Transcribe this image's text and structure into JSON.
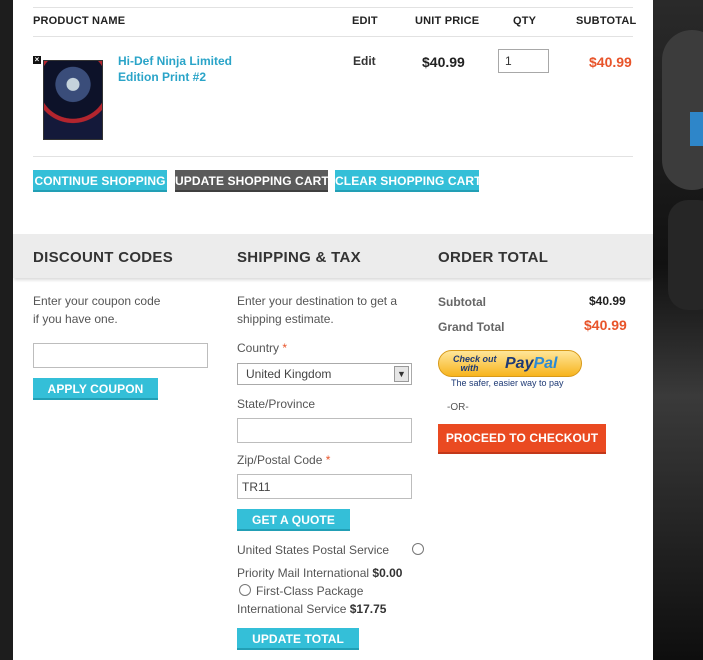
{
  "table": {
    "headers": [
      "PRODUCT NAME",
      "EDIT",
      "UNIT PRICE",
      "QTY",
      "SUBTOTAL"
    ],
    "item": {
      "name": "Hi-Def Ninja Limited Edition Print #2",
      "edit": "Edit",
      "unit_price": "$40.99",
      "qty": "1",
      "subtotal": "$40.99"
    }
  },
  "cart_buttons": {
    "continue": "CONTINUE SHOPPING",
    "update": "UPDATE SHOPPING CART",
    "clear": "CLEAR SHOPPING CART"
  },
  "discount": {
    "title": "DISCOUNT CODES",
    "line1": "Enter your coupon code",
    "line2": "if you have one.",
    "coupon_value": "",
    "apply": "APPLY COUPON"
  },
  "shipping": {
    "title": "SHIPPING & TAX",
    "line1": "Enter your destination to get a",
    "line2": "shipping estimate.",
    "country_label": "Country",
    "country_value": "United Kingdom",
    "state_label": "State/Province",
    "state_value": "",
    "zip_label": "Zip/Postal Code",
    "zip_value": "TR11",
    "required_mark": "*",
    "quote_button": "GET A QUOTE",
    "carrier": "United States Postal Service",
    "option1_name": "Priority Mail International",
    "option1_price": "$0.00",
    "option2_name_line1": "First-Class Package",
    "option2_name_line2": "International Service",
    "option2_price": "$17.75",
    "update_button": "UPDATE TOTAL"
  },
  "order_total": {
    "title": "ORDER TOTAL",
    "subtotal_label": "Subtotal",
    "subtotal_value": "$40.99",
    "grand_label": "Grand Total",
    "grand_value": "$40.99",
    "paypal_small_1": "Check out",
    "paypal_small_2": "with",
    "paypal_logo_1": "Pay",
    "paypal_logo_2": "Pal",
    "paypal_tagline": "The safer, easier way to pay",
    "or": "-OR-",
    "checkout": "PROCEED TO CHECKOUT"
  },
  "icons": {
    "remove": "remove-x-icon",
    "dropdown": "chevron-down-icon",
    "radio": "radio-icon"
  },
  "colors": {
    "accent": "#34bfd8",
    "price": "#e8542a",
    "link": "#2aa4c8",
    "checkout": "#ea4a21"
  }
}
